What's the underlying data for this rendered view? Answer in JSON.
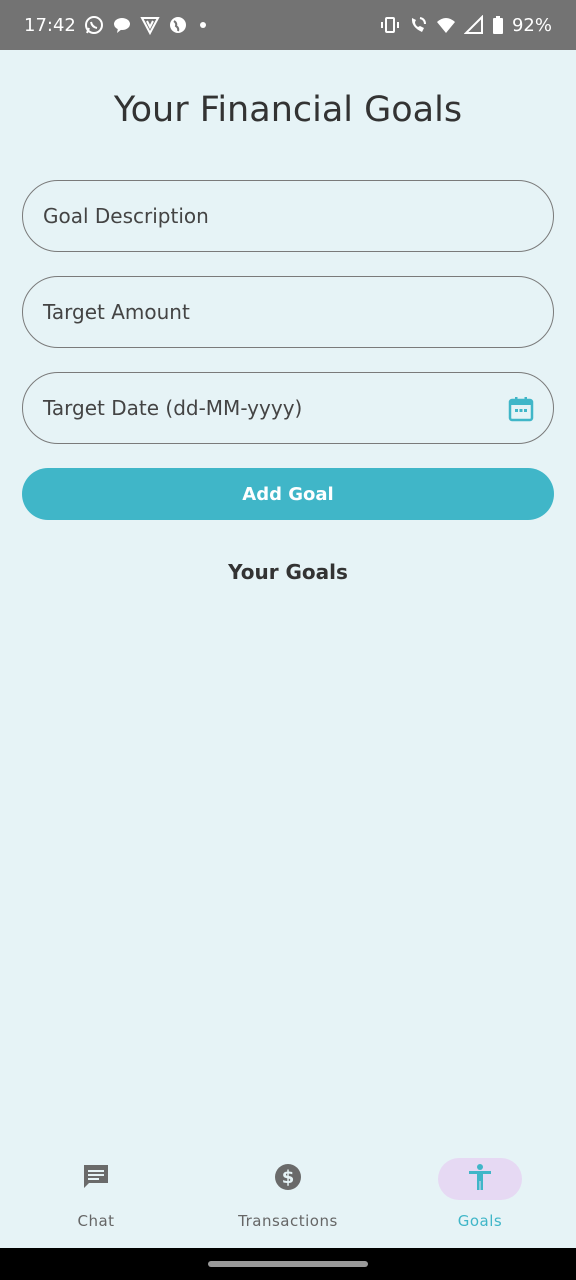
{
  "status_bar": {
    "time": "17:42",
    "battery": "92%",
    "left_icons": [
      "whatsapp-icon",
      "chat-bubble-icon",
      "vpn-shield-icon",
      "globe-icon",
      "dot-icon"
    ],
    "right_icons": [
      "vibrate-icon",
      "wifi-call-icon",
      "wifi-icon",
      "signal-icon",
      "battery-icon"
    ]
  },
  "page": {
    "title": "Your Financial Goals"
  },
  "form": {
    "description_placeholder": "Goal Description",
    "amount_placeholder": "Target Amount",
    "date_placeholder": "Target Date (dd-MM-yyyy)",
    "add_button_label": "Add Goal"
  },
  "goals_section": {
    "heading": "Your Goals",
    "items": []
  },
  "bottom_nav": {
    "items": [
      {
        "label": "Chat",
        "icon": "chat-icon"
      },
      {
        "label": "Transactions",
        "icon": "dollar-icon"
      },
      {
        "label": "Goals",
        "icon": "accessibility-icon",
        "active": true
      }
    ]
  },
  "colors": {
    "accent": "#40b6c8",
    "background": "#e6f3f6",
    "active_pill": "#e6d9f3",
    "status_bar": "#737373"
  }
}
